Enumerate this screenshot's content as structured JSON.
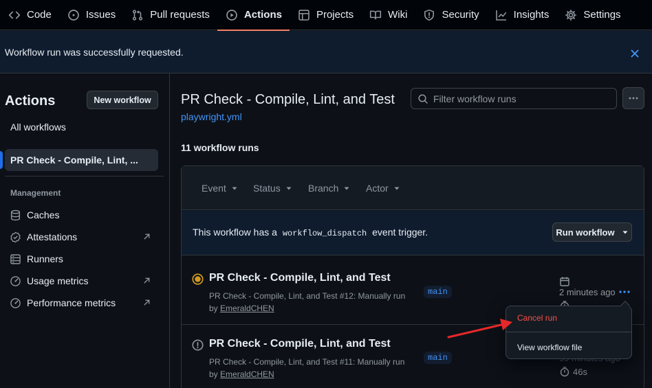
{
  "repo_nav": {
    "tabs": [
      {
        "label": "Code",
        "icon": "code-icon"
      },
      {
        "label": "Issues",
        "icon": "issue-opened-icon"
      },
      {
        "label": "Pull requests",
        "icon": "git-pull-request-icon"
      },
      {
        "label": "Actions",
        "icon": "play-icon",
        "active": true
      },
      {
        "label": "Projects",
        "icon": "table-icon"
      },
      {
        "label": "Wiki",
        "icon": "book-icon"
      },
      {
        "label": "Security",
        "icon": "shield-icon"
      },
      {
        "label": "Insights",
        "icon": "graph-icon"
      },
      {
        "label": "Settings",
        "icon": "gear-icon"
      }
    ]
  },
  "flash": {
    "message": "Workflow run was successfully requested.",
    "close_icon": "x-icon"
  },
  "sidebar": {
    "title": "Actions",
    "new_workflow_label": "New workflow",
    "all_workflows_label": "All workflows",
    "selected_workflow_label": "PR Check - Compile, Lint, ...",
    "management_heading": "Management",
    "management_items": [
      {
        "label": "Caches",
        "icon": "database-icon",
        "external": false
      },
      {
        "label": "Attestations",
        "icon": "verified-icon",
        "external": true
      },
      {
        "label": "Runners",
        "icon": "server-icon",
        "external": false
      },
      {
        "label": "Usage metrics",
        "icon": "meter-icon",
        "external": true
      },
      {
        "label": "Performance metrics",
        "icon": "meter-icon",
        "external": true
      }
    ]
  },
  "main": {
    "title": "PR Check - Compile, Lint, and Test",
    "file_link": "playwright.yml",
    "filter_placeholder": "Filter workflow runs",
    "runs_count": "11 workflow runs",
    "filters": [
      "Event",
      "Status",
      "Branch",
      "Actor"
    ],
    "dispatch": {
      "text_before": "This workflow has a",
      "code": "workflow_dispatch",
      "text_after": "event trigger.",
      "button_label": "Run workflow"
    },
    "runs": [
      {
        "title": "PR Check - Compile, Lint, and Test",
        "subtitle": "PR Check - Compile, Lint, and Test #12: Manually run",
        "by_prefix": "by",
        "actor": "EmeraldCHEN",
        "branch": "main",
        "time": "2 minutes ago",
        "status": "in-progress"
      },
      {
        "title": "PR Check - Compile, Lint, and Test",
        "subtitle": "PR Check - Compile, Lint, and Test #11: Manually run",
        "by_prefix": "by",
        "actor": "EmeraldCHEN",
        "branch": "main",
        "time": "59 minutes ago",
        "duration": "46s",
        "status": "failed"
      }
    ],
    "run_menu": {
      "items": [
        "Cancel run",
        "View workflow file"
      ]
    }
  },
  "colors": {
    "accent_blue": "#4493f8",
    "danger_red": "#f85149",
    "in_progress": "#d29922",
    "active_tab_underline": "#f78166",
    "annotation_arrow": "#e5282a"
  }
}
